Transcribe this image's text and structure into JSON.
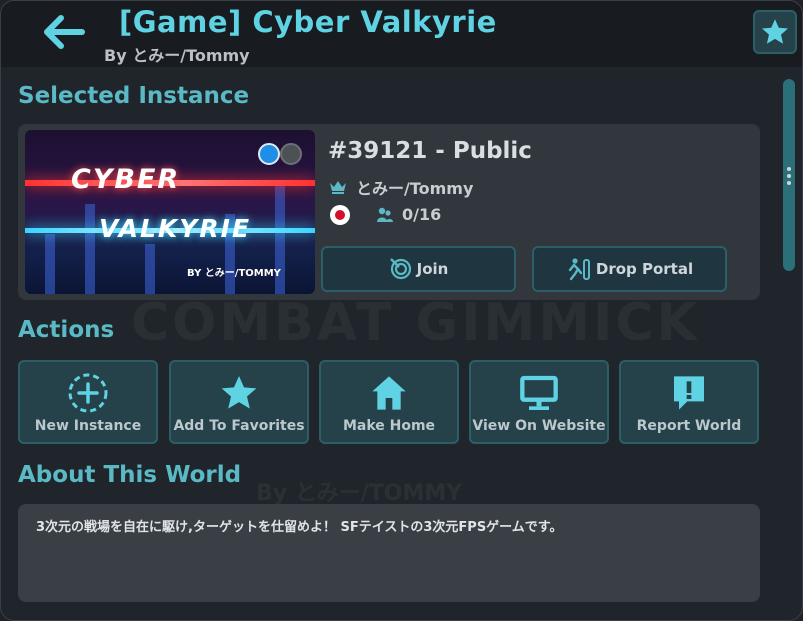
{
  "header": {
    "title": "[Game]  Cyber Valkyrie",
    "author": "By とみー/Tommy"
  },
  "selected_instance": {
    "section_label": "Selected Instance",
    "thumbnail_text": [
      "CYBER",
      "VALKYRIE",
      "BY とみー/TOMMY"
    ],
    "instance_title": "#39121 - Public",
    "owner": "とみー/Tommy",
    "player_count": "0/16",
    "join_label": "Join",
    "drop_portal_label": "Drop Portal"
  },
  "actions": {
    "section_label": "Actions",
    "buttons": [
      {
        "label": "New Instance",
        "icon": "plus-circle-icon"
      },
      {
        "label": "Add To Favorites",
        "icon": "star-icon"
      },
      {
        "label": "Make Home",
        "icon": "home-icon"
      },
      {
        "label": "View On Website",
        "icon": "monitor-icon"
      },
      {
        "label": "Report World",
        "icon": "report-icon"
      }
    ]
  },
  "about": {
    "section_label": "About This World",
    "description": "3次元の戦場を自在に駆け,ターゲットを仕留めよ！ SFテイストの3次元FPSゲームです。"
  },
  "background_text": [
    "COMBAT GIMMICK",
    "By とみー/TOMMY"
  ],
  "colors": {
    "accent": "#5fd3e3",
    "section": "#5ab9c4",
    "button_bg": "#25414a",
    "button_border": "#2c5f65"
  }
}
